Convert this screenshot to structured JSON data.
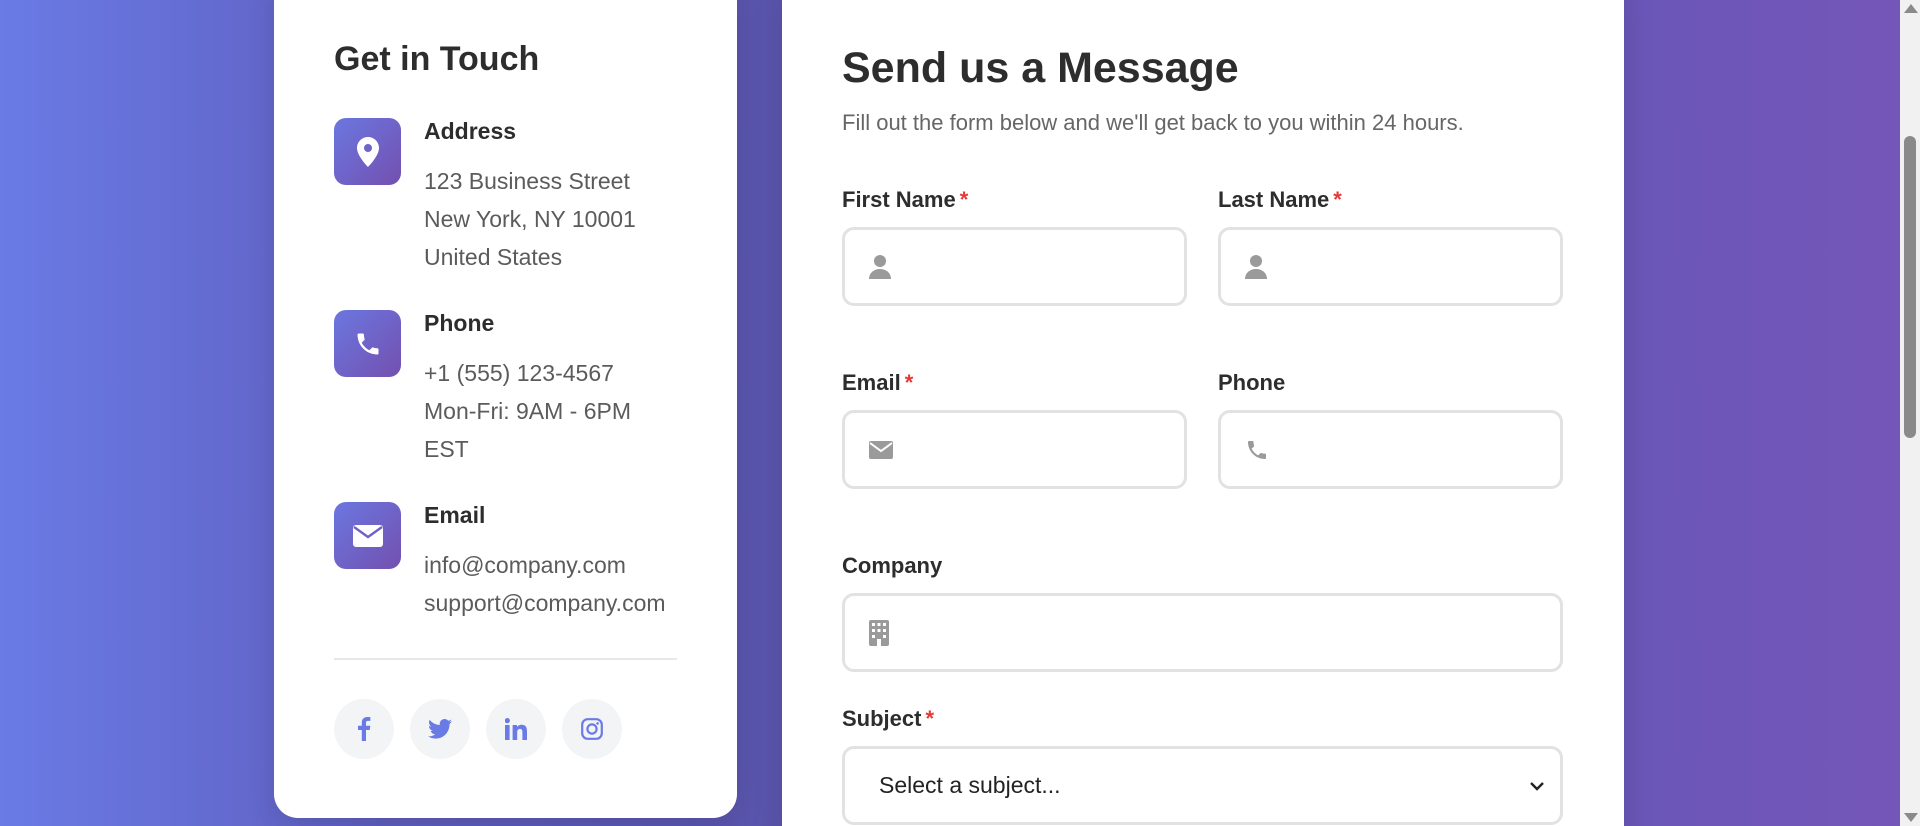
{
  "contact_info": {
    "title": "Get in Touch",
    "address": {
      "heading": "Address",
      "lines": [
        "123 Business Street",
        "New York, NY 10001",
        "United States"
      ],
      "icon": "map-pin-icon"
    },
    "phone": {
      "heading": "Phone",
      "lines": [
        "+1 (555) 123-4567",
        "Mon-Fri: 9AM - 6PM",
        "EST"
      ],
      "icon": "phone-icon"
    },
    "email": {
      "heading": "Email",
      "lines": [
        "info@company.com",
        "support@company.com"
      ],
      "icon": "envelope-icon"
    },
    "socials": [
      "facebook-icon",
      "twitter-icon",
      "linkedin-icon",
      "instagram-icon"
    ]
  },
  "form": {
    "title": "Send us a Message",
    "subtitle": "Fill out the form below and we'll get back to you within 24 hours.",
    "first_name": {
      "label": "First Name",
      "required_mark": "*",
      "value": ""
    },
    "last_name": {
      "label": "Last Name",
      "required_mark": "*",
      "value": ""
    },
    "email": {
      "label": "Email",
      "required_mark": "*",
      "value": ""
    },
    "phone": {
      "label": "Phone",
      "value": ""
    },
    "company": {
      "label": "Company",
      "value": ""
    },
    "subject": {
      "label": "Subject",
      "required_mark": "*",
      "selected": "Select a subject..."
    }
  },
  "colors": {
    "accent_gradient_start": "#6b77e0",
    "accent_gradient_end": "#7350b0",
    "required": "#e53935",
    "social_icon": "#6a7be5"
  }
}
